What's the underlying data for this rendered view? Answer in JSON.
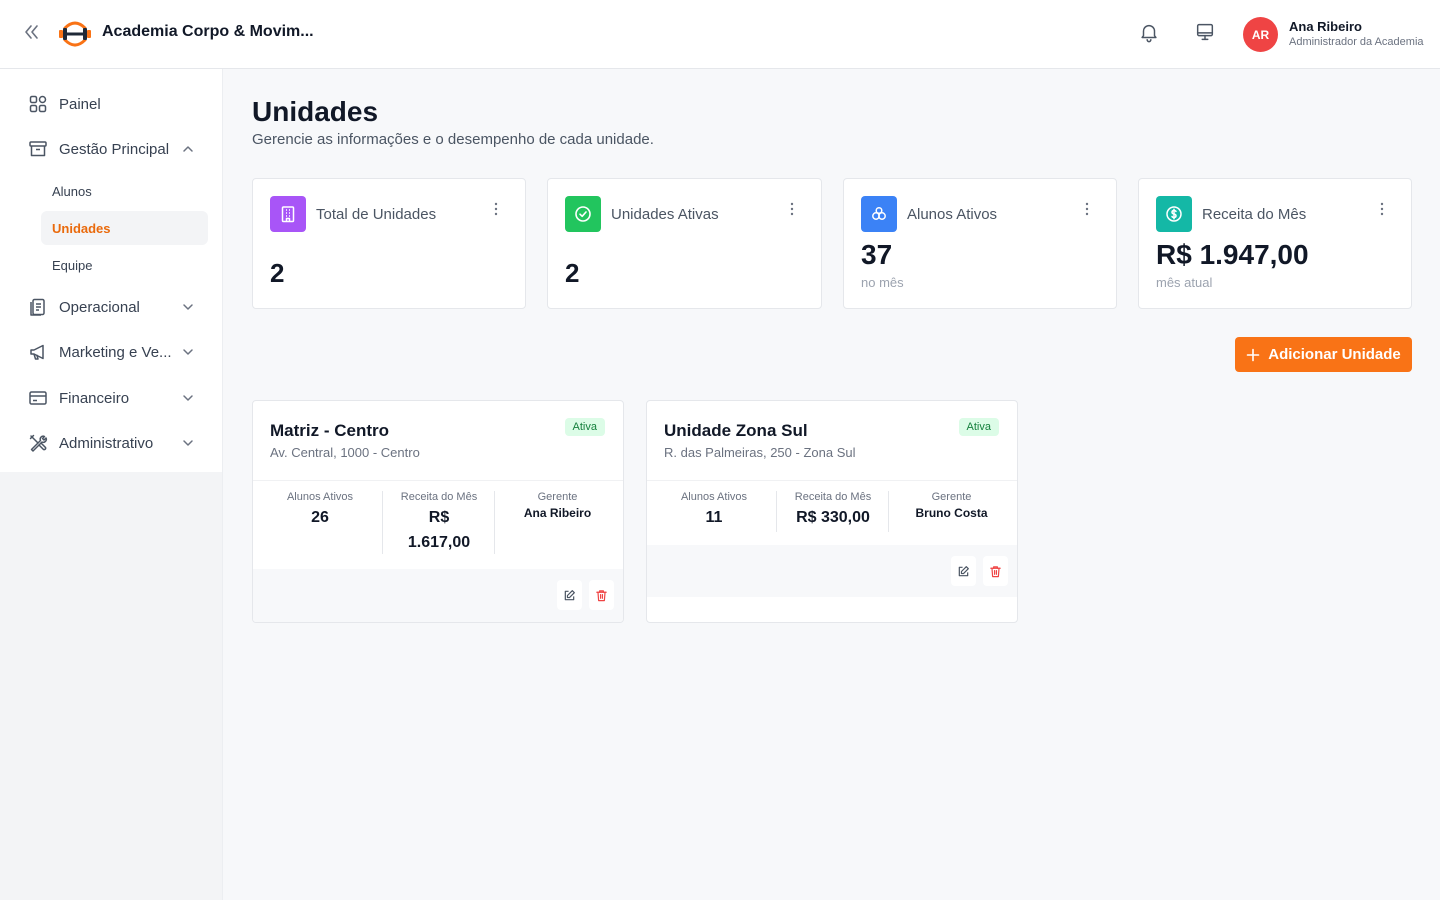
{
  "header": {
    "brand_name": "Academia Corpo & Movim...",
    "user_initials": "AR",
    "user_name": "Ana Ribeiro",
    "user_role": "Administrador da Academia"
  },
  "sidebar": {
    "painel": "Painel",
    "gestao": "Gestão Principal",
    "sub_alunos": "Alunos",
    "sub_unidades": "Unidades",
    "sub_equipe": "Equipe",
    "operacional": "Operacional",
    "marketing": "Marketing e Ve...",
    "financeiro": "Financeiro",
    "administrativo": "Administrativo"
  },
  "page": {
    "title": "Unidades",
    "subtitle": "Gerencie as informações e o desempenho de cada unidade."
  },
  "stats": [
    {
      "label": "Total de Unidades",
      "value": "2",
      "icon": "building-icon",
      "color": "#a855f7"
    },
    {
      "label": "Unidades Ativas",
      "value": "2",
      "icon": "check-circle-icon",
      "color": "#22c55e"
    },
    {
      "label": "Alunos Ativos",
      "value": "37",
      "note": "no mês",
      "icon": "users-icon",
      "color": "#3b82f6"
    },
    {
      "label": "Receita do Mês",
      "value": "R$ 1.947,00",
      "note": "mês atual",
      "icon": "dollar-circle-icon",
      "color": "#14b8a6"
    }
  ],
  "add_button_label": "Adicionar Unidade",
  "units": [
    {
      "name": "Matriz - Centro",
      "address": "Av. Central, 1000 - Centro",
      "status": "Ativa",
      "students_label": "Alunos Ativos",
      "students": "26",
      "revenue_label": "Receita do Mês",
      "revenue_line1": "R$",
      "revenue_line2": "1.617,00",
      "manager_label": "Gerente",
      "manager": "Ana Ribeiro"
    },
    {
      "name": "Unidade Zona Sul",
      "address": "R. das Palmeiras, 250 - Zona Sul",
      "status": "Ativa",
      "students_label": "Alunos Ativos",
      "students": "11",
      "revenue_label": "Receita do Mês",
      "revenue": "R$ 330,00",
      "manager_label": "Gerente",
      "manager": "Bruno Costa"
    }
  ],
  "colors": {
    "accent": "#f97316",
    "active_text": "#ea6a0c",
    "danger": "#ef4444",
    "badge_bg": "#dcfce7",
    "badge_text": "#15803d"
  }
}
